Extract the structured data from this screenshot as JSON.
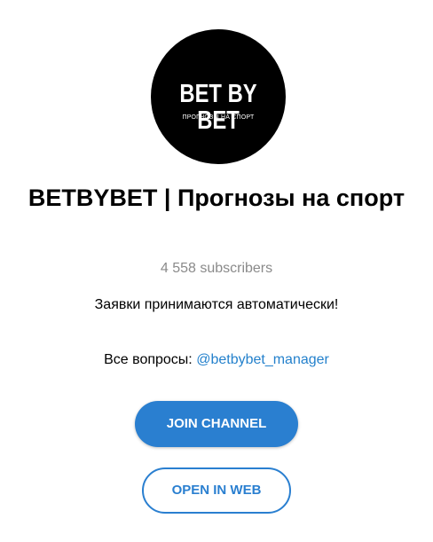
{
  "channel": {
    "avatar": {
      "logo_text": "BET BY BET",
      "logo_subtext": "ПРОГНОЗЫ НА СПОРТ",
      "background": "#000000"
    },
    "title": "BETBYBET | Прогнозы на спорт",
    "subscribers": "4 558 subscribers",
    "description": "Заявки принимаются автоматически!",
    "contact_prefix": "Все вопросы: ",
    "contact_link": "@betbybet_manager"
  },
  "actions": {
    "join_label": "JOIN CHANNEL",
    "open_web_label": "OPEN IN WEB"
  },
  "colors": {
    "accent": "#2a7fd0",
    "link": "#2481cc",
    "muted_text": "#8a8a8a"
  }
}
